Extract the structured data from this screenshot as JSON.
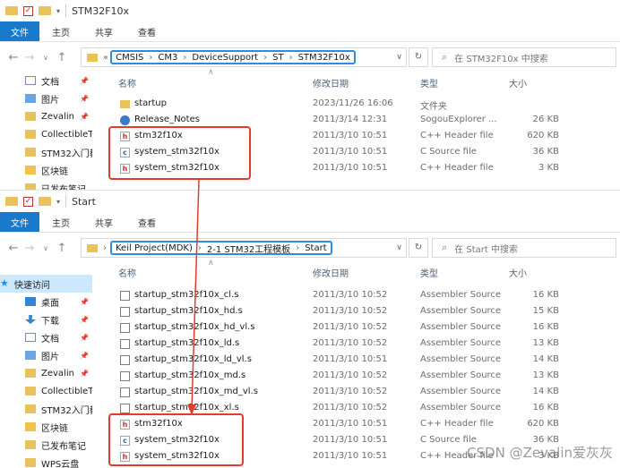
{
  "window1": {
    "title": "STM32F10x",
    "ribbon_tabs": [
      "文件",
      "主页",
      "共享",
      "查看"
    ],
    "breadcrumb": [
      "CMSIS",
      "CM3",
      "DeviceSupport",
      "ST",
      "STM32F10x"
    ],
    "breadcrumb_prefix": "«",
    "search_placeholder": "在 STM32F10x 中搜索",
    "nav_items": [
      {
        "label": "文档",
        "icon": "doc"
      },
      {
        "label": "图片",
        "icon": "img"
      },
      {
        "label": "Zevalin",
        "icon": "folder"
      },
      {
        "label": "CollectibleT",
        "icon": "folder"
      },
      {
        "label": "STM32入门教",
        "icon": "folder"
      },
      {
        "label": "区块链",
        "icon": "chain"
      },
      {
        "label": "已发布笔记",
        "icon": "folder"
      }
    ],
    "columns": {
      "name": "名称",
      "date": "修改日期",
      "type": "类型",
      "size": "大小"
    },
    "files": [
      {
        "name": "startup",
        "date": "2023/11/26 16:06",
        "type": "文件夹",
        "size": "",
        "icon": "folder"
      },
      {
        "name": "Release_Notes",
        "date": "2011/3/14 12:31",
        "type": "SogouExplorer ...",
        "size": "26 KB",
        "icon": "sogou"
      },
      {
        "name": "stm32f10x",
        "date": "2011/3/10 10:51",
        "type": "C++ Header file",
        "size": "620 KB",
        "icon": "h"
      },
      {
        "name": "system_stm32f10x",
        "date": "2011/3/10 10:51",
        "type": "C Source file",
        "size": "36 KB",
        "icon": "c"
      },
      {
        "name": "system_stm32f10x",
        "date": "2011/3/10 10:51",
        "type": "C++ Header file",
        "size": "3 KB",
        "icon": "h"
      }
    ]
  },
  "window2": {
    "title": "Start",
    "ribbon_tabs": [
      "文件",
      "主页",
      "共享",
      "查看"
    ],
    "breadcrumb": [
      "Keil Project(MDK)",
      "2-1 STM32工程模板",
      "Start"
    ],
    "search_placeholder": "在 Start 中搜索",
    "nav_items": [
      {
        "label": "快速访问",
        "icon": "star",
        "selected": true
      },
      {
        "label": "桌面",
        "icon": "desk"
      },
      {
        "label": "下载",
        "icon": "dl"
      },
      {
        "label": "文档",
        "icon": "doc"
      },
      {
        "label": "图片",
        "icon": "img"
      },
      {
        "label": "Zevalin",
        "icon": "folder"
      },
      {
        "label": "CollectibleT",
        "icon": "folder"
      },
      {
        "label": "STM32入门教",
        "icon": "folder"
      },
      {
        "label": "区块链",
        "icon": "chain"
      },
      {
        "label": "已发布笔记",
        "icon": "folder"
      },
      {
        "label": "WPS云盘",
        "icon": "folder"
      }
    ],
    "columns": {
      "name": "名称",
      "date": "修改日期",
      "type": "类型",
      "size": "大小"
    },
    "files": [
      {
        "name": "startup_stm32f10x_cl.s",
        "date": "2011/3/10 10:52",
        "type": "Assembler Source",
        "size": "16 KB",
        "icon": "asm"
      },
      {
        "name": "startup_stm32f10x_hd.s",
        "date": "2011/3/10 10:52",
        "type": "Assembler Source",
        "size": "15 KB",
        "icon": "asm"
      },
      {
        "name": "startup_stm32f10x_hd_vl.s",
        "date": "2011/3/10 10:52",
        "type": "Assembler Source",
        "size": "16 KB",
        "icon": "asm"
      },
      {
        "name": "startup_stm32f10x_ld.s",
        "date": "2011/3/10 10:52",
        "type": "Assembler Source",
        "size": "13 KB",
        "icon": "asm"
      },
      {
        "name": "startup_stm32f10x_ld_vl.s",
        "date": "2011/3/10 10:51",
        "type": "Assembler Source",
        "size": "14 KB",
        "icon": "asm"
      },
      {
        "name": "startup_stm32f10x_md.s",
        "date": "2011/3/10 10:52",
        "type": "Assembler Source",
        "size": "13 KB",
        "icon": "asm"
      },
      {
        "name": "startup_stm32f10x_md_vl.s",
        "date": "2011/3/10 10:52",
        "type": "Assembler Source",
        "size": "14 KB",
        "icon": "asm"
      },
      {
        "name": "startup_stm32f10x_xl.s",
        "date": "2011/3/10 10:52",
        "type": "Assembler Source",
        "size": "16 KB",
        "icon": "asm"
      },
      {
        "name": "stm32f10x",
        "date": "2011/3/10 10:51",
        "type": "C++ Header file",
        "size": "620 KB",
        "icon": "h"
      },
      {
        "name": "system_stm32f10x",
        "date": "2011/3/10 10:51",
        "type": "C Source file",
        "size": "36 KB",
        "icon": "c"
      },
      {
        "name": "system_stm32f10x",
        "date": "2011/3/10 10:51",
        "type": "C++ Header file",
        "size": "3 KB",
        "icon": "h"
      }
    ]
  },
  "watermark": "CSDN @Zevalin爱灰灰",
  "colors": {
    "accent": "#1979ca",
    "highlight_box": "#2b8ce8",
    "annotation_red": "#e23b2f"
  }
}
